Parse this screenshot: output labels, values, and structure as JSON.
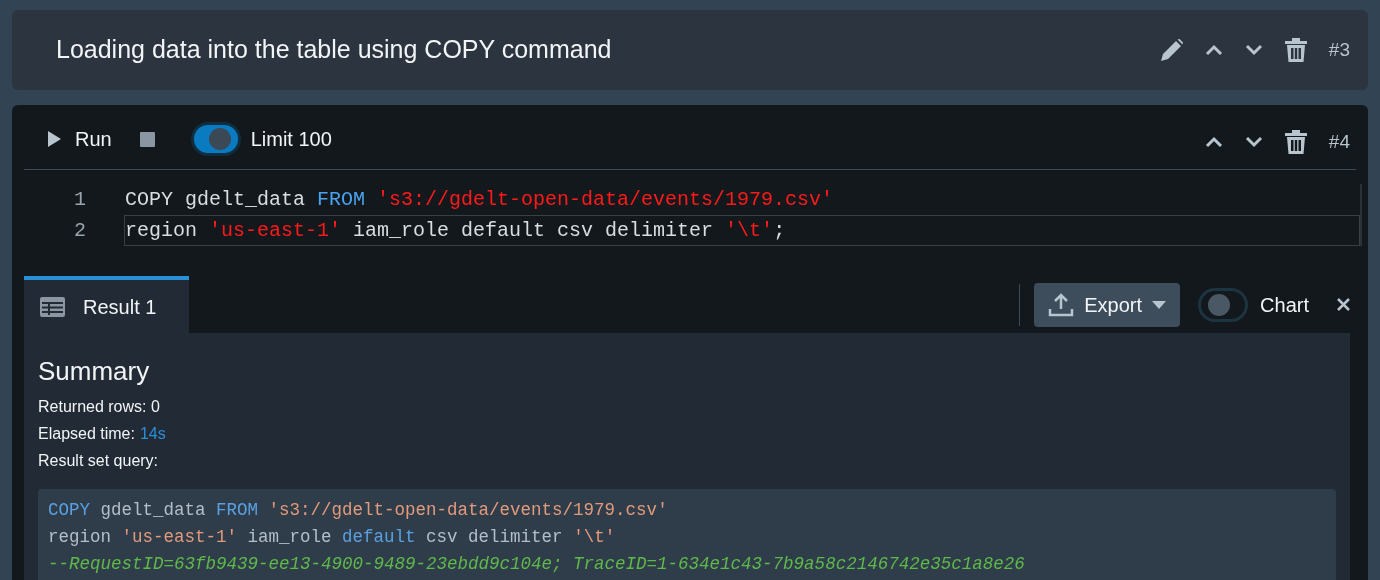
{
  "text_cell": {
    "title": "Loading data into the table using COPY command",
    "number": "#3"
  },
  "query_cell": {
    "number": "#4",
    "run_label": "Run",
    "limit": {
      "label": "Limit 100",
      "on": true
    },
    "editor_lines": [
      {
        "number": "1",
        "current": false,
        "tokens": [
          {
            "kind": "text",
            "text": "COPY gdelt_data "
          },
          {
            "kind": "keyword",
            "text": "FROM "
          },
          {
            "kind": "string",
            "text": "'s3://gdelt-open-data/events/1979.csv'"
          }
        ]
      },
      {
        "number": "2",
        "current": true,
        "tokens": [
          {
            "kind": "text",
            "text": "region "
          },
          {
            "kind": "string",
            "text": "'us-east-1'"
          },
          {
            "kind": "text",
            "text": " iam_role default csv delimiter "
          },
          {
            "kind": "string",
            "text": "'\\t'"
          },
          {
            "kind": "text",
            "text": ";"
          }
        ]
      }
    ]
  },
  "results": {
    "tabs": [
      {
        "label": "Result 1",
        "selected": true
      }
    ],
    "export_label": "Export",
    "chart": {
      "label": "Chart",
      "on": false
    },
    "summary": {
      "title": "Summary",
      "returned_rows": "Returned rows: 0",
      "elapsed_label": "Elapsed time:",
      "elapsed_value": "14s",
      "query_label": "Result set query:"
    },
    "query_lines": [
      [
        {
          "kind": "keyword",
          "text": "COPY"
        },
        {
          "kind": "text",
          "text": " gdelt_data "
        },
        {
          "kind": "keyword",
          "text": "FROM "
        },
        {
          "kind": "string",
          "text": "'s3://gdelt-open-data/events/1979.csv'"
        }
      ],
      [
        {
          "kind": "text",
          "text": "region "
        },
        {
          "kind": "string",
          "text": "'us-east-1'"
        },
        {
          "kind": "text",
          "text": " iam_role "
        },
        {
          "kind": "keyword",
          "text": "default"
        },
        {
          "kind": "text",
          "text": " csv delimiter "
        },
        {
          "kind": "string",
          "text": "'\\t'"
        }
      ],
      [
        {
          "kind": "comment",
          "text": "--RequestID=63fb9439-ee13-4900-9489-23ebdd9c104e; TraceID=1-634e1c43-7b9a58c2146742e35c1a8e26"
        }
      ]
    ]
  }
}
